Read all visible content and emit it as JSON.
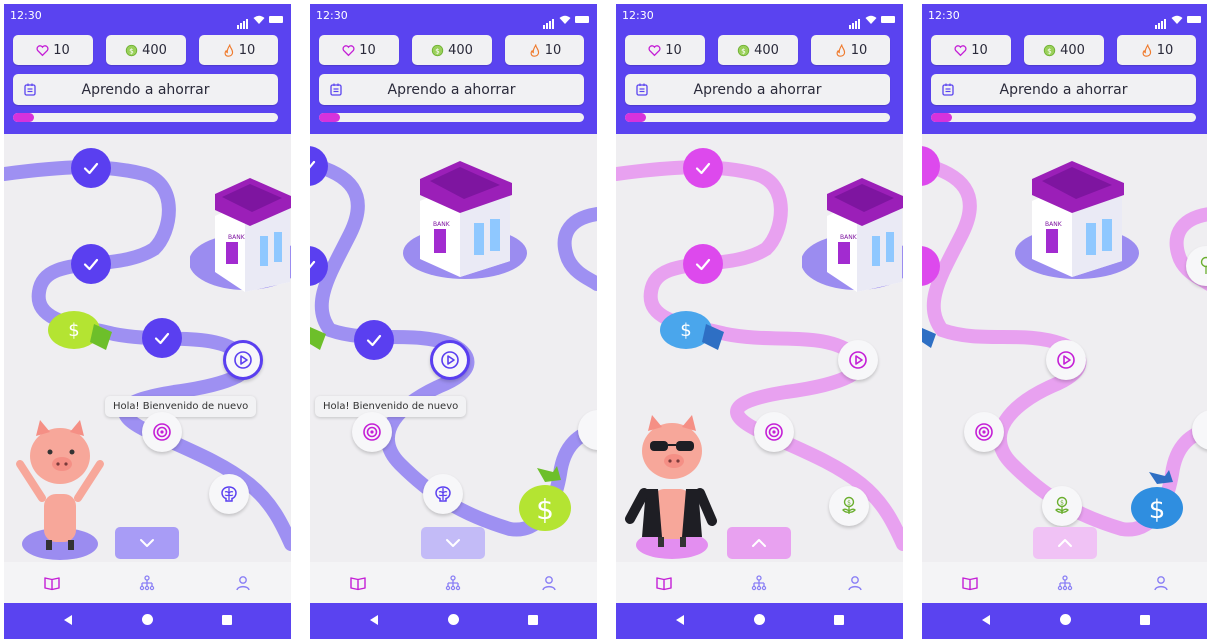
{
  "status": {
    "time": "12:30"
  },
  "stats": {
    "hearts": "10",
    "coins": "400",
    "streak": "10"
  },
  "goal": {
    "title": "Aprendo a ahorrar",
    "progress": 0.08
  },
  "speech": {
    "text": "Hola! Bienvenido de nuevo"
  },
  "icons": {
    "heart": "heart-icon",
    "coin": "coin-icon",
    "flame": "flame-icon",
    "goal": "calendar-icon",
    "check": "check-icon",
    "play": "play-icon",
    "target": "target-icon",
    "brain": "brain-icon",
    "plant": "money-plant-icon",
    "book": "book-icon",
    "tree": "hierarchy-icon",
    "profile": "person-icon",
    "chevron_down": "chevron-down-icon",
    "chevron_up": "chevron-up-icon"
  },
  "colors": {
    "header": "#5a43f0",
    "violet_path": "#9b8cf0",
    "pink_path": "#e8a1f0",
    "violet_done": "#5a3ff0",
    "pink_done": "#dd49ed",
    "progress": "#d632dc",
    "nav_active": "#c41fd6",
    "nav_inactive": "#8a7ff5"
  }
}
